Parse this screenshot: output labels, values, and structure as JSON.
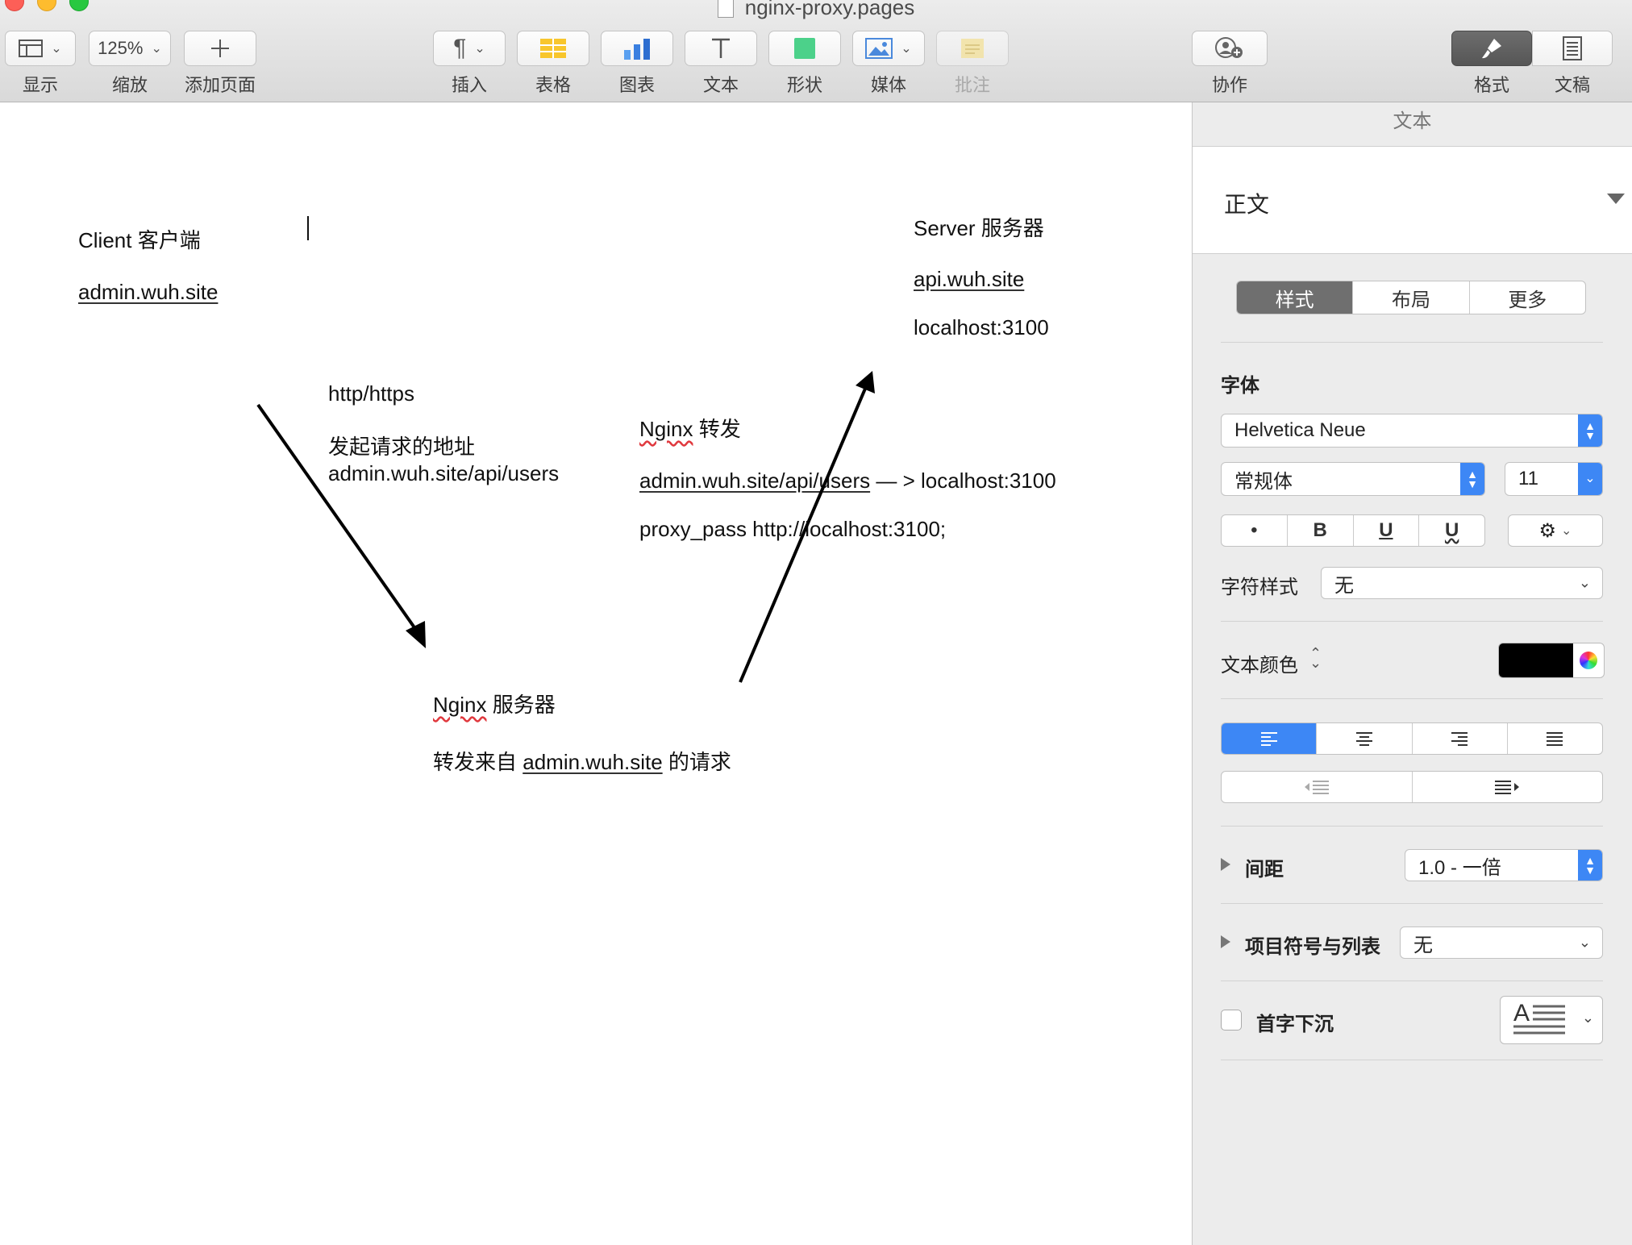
{
  "window": {
    "title": "nginx-proxy.pages"
  },
  "toolbar": {
    "zoom_value": "125%",
    "labels": {
      "view": "显示",
      "zoom": "缩放",
      "add_page": "添加页面",
      "insert": "插入",
      "table": "表格",
      "chart": "图表",
      "text": "文本",
      "shape": "形状",
      "media": "媒体",
      "comment": "批注",
      "collaborate": "协作",
      "format": "格式",
      "document": "文稿"
    }
  },
  "document": {
    "client_title": "Client 客户端",
    "client_domain": "admin.wuh.site",
    "server_title": "Server 服务器",
    "server_domain": "api.wuh.site",
    "server_local": "localhost:3100",
    "http_label": "http/https",
    "request_label": "发起请求的地址",
    "request_url": "admin.wuh.site/api/users",
    "nginx_forward_word": "Nginx",
    "nginx_forward_rest": " 转发",
    "forward_src": "admin.wuh.site/api/users",
    "forward_dst": " — > localhost:3100",
    "proxy_pass": "proxy_pass http://localhost:3100;",
    "nginx_server_word": "Nginx",
    "nginx_server_rest": " 服务器",
    "nginx_desc_pre": "转发来自 ",
    "nginx_desc_link": "admin.wuh.site",
    "nginx_desc_post": " 的请求"
  },
  "inspector": {
    "header": "文本",
    "paragraph_style": "正文",
    "tabs": [
      "样式",
      "布局",
      "更多"
    ],
    "font_section": "字体",
    "font_family": "Helvetica Neue",
    "font_typeface": "常规体",
    "font_size": "11",
    "style_buttons": [
      "•",
      "B",
      "U",
      "U"
    ],
    "char_style_label": "字符样式",
    "char_style_value": "无",
    "text_color_label": "文本颜色",
    "text_color": "#000000",
    "spacing_label": "间距",
    "spacing_value": "1.0 - 一倍",
    "bullets_label": "项目符号与列表",
    "bullets_value": "无",
    "dropcap_label": "首字下沉"
  }
}
